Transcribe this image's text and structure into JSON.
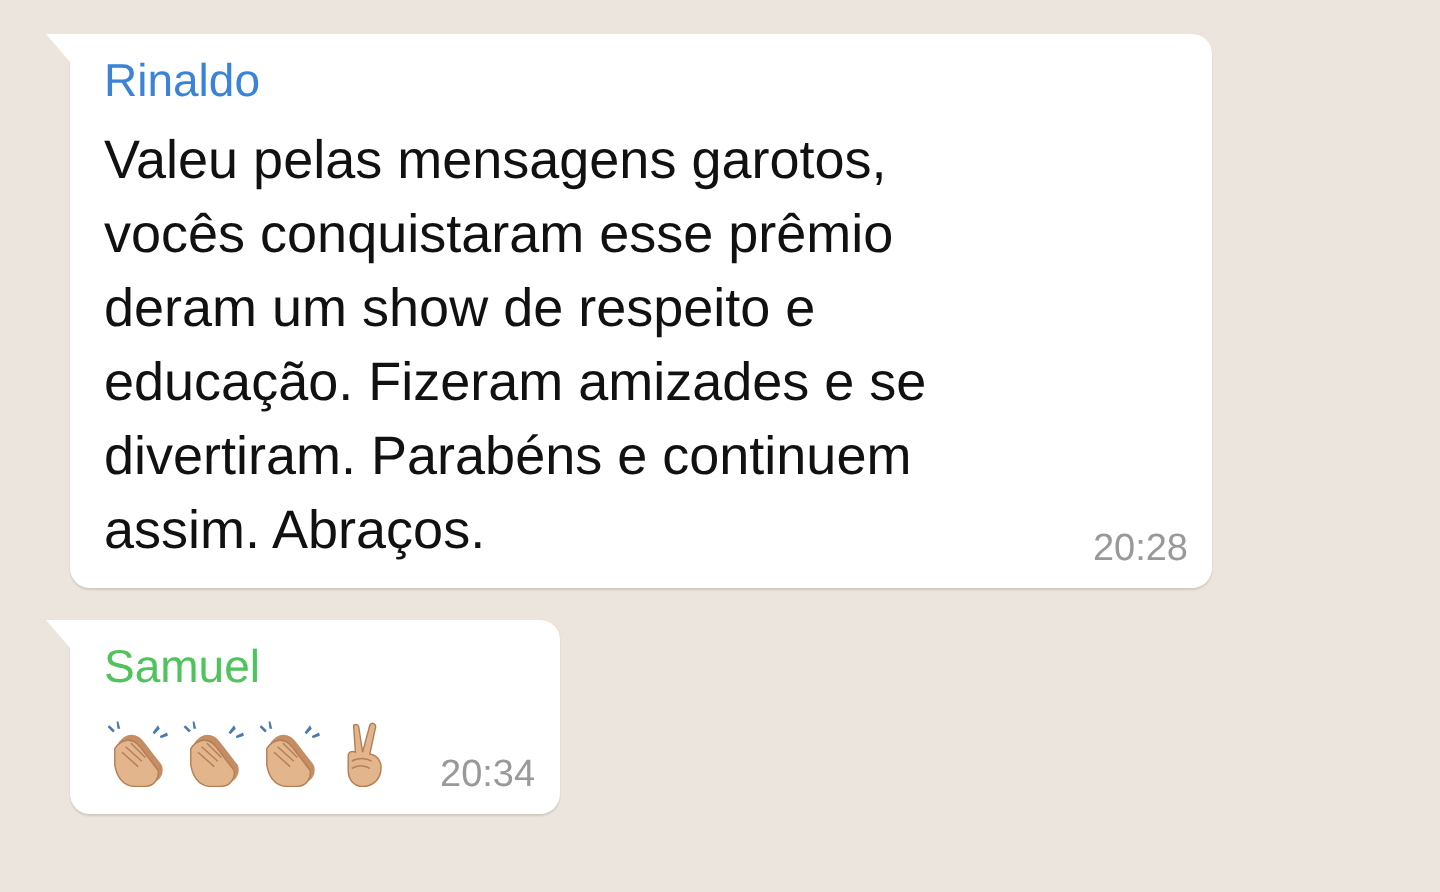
{
  "messages": [
    {
      "sender": "Rinaldo",
      "color": "#3a83d6",
      "text": "Valeu pelas mensagens garotos,\nvocês conquistaram esse prêmio\nderam um show de respeito e\neducação. Fizeram amizades e se\ndivertiram. Parabéns e continuem\nassim. Abraços.",
      "time": "20:28"
    },
    {
      "sender": "Samuel",
      "color": "#4fc35c",
      "emojis": [
        {
          "kind": "clap"
        },
        {
          "kind": "clap"
        },
        {
          "kind": "clap"
        },
        {
          "kind": "victory"
        }
      ],
      "time": "20:34"
    }
  ]
}
